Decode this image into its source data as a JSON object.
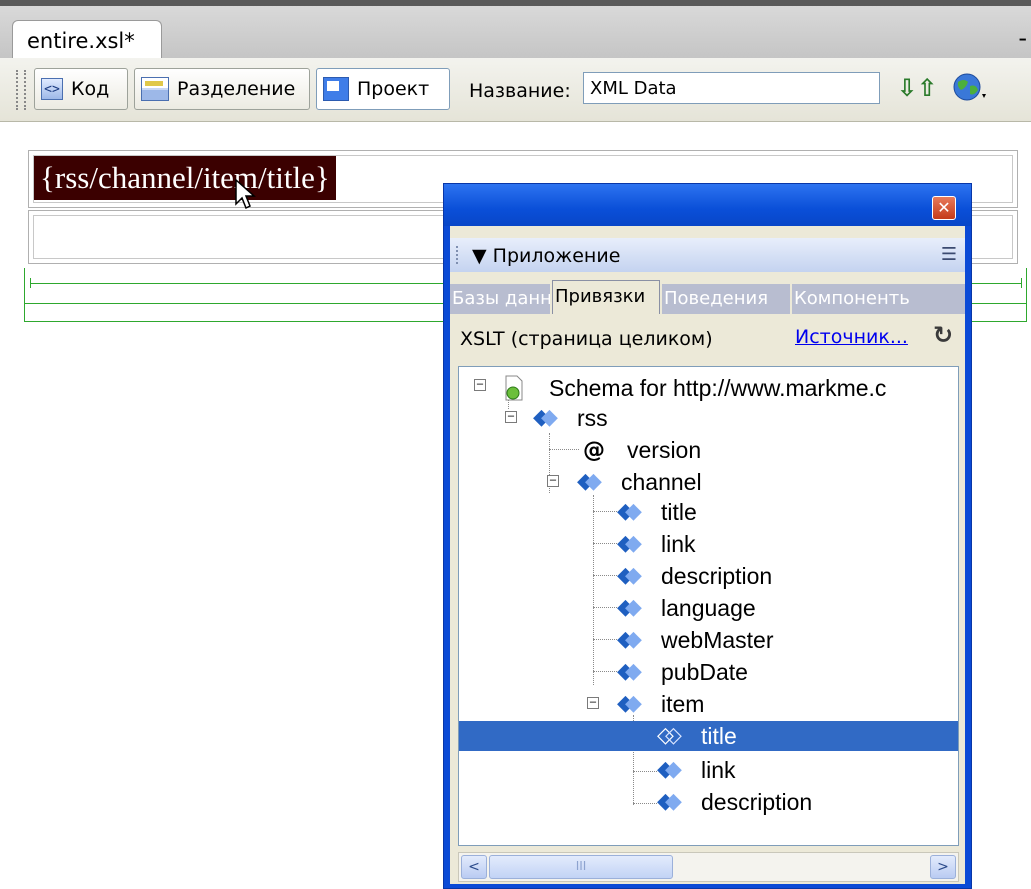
{
  "document": {
    "tab_title": "entire.xsl*",
    "minimize_glyph": "-"
  },
  "toolbar": {
    "code_label": "Код",
    "split_label": "Разделение",
    "design_label": "Проект",
    "title_label": "Название:",
    "title_value": "XML Data",
    "sort_glyph": "⇩⇧"
  },
  "design": {
    "xsl_field": "{rss/channel/item/title}"
  },
  "panel": {
    "close_glyph": "✕",
    "group_title": "▼ Приложение",
    "options_glyph": "☰",
    "tabs": [
      "Базы данны",
      "Привязки",
      "Поведения",
      "Компоненть"
    ],
    "active_tab": 1,
    "source_type": "XSLT (страница целиком)",
    "source_link": "Источник...",
    "refresh_glyph": "↻",
    "tree": [
      {
        "label": "Schema for http://www.markme.c",
        "type": "schema"
      },
      {
        "label": "rss",
        "type": "element"
      },
      {
        "label": "version",
        "type": "attribute"
      },
      {
        "label": "channel",
        "type": "element"
      },
      {
        "label": "title",
        "type": "element"
      },
      {
        "label": "link",
        "type": "element"
      },
      {
        "label": "description",
        "type": "element"
      },
      {
        "label": "language",
        "type": "element"
      },
      {
        "label": "webMaster",
        "type": "element"
      },
      {
        "label": "pubDate",
        "type": "element"
      },
      {
        "label": "item",
        "type": "element-repeating"
      },
      {
        "label": "title",
        "type": "element",
        "selected": true
      },
      {
        "label": "link",
        "type": "element"
      },
      {
        "label": "description",
        "type": "element"
      }
    ],
    "scroll": {
      "left": "<",
      "right": ">",
      "thumb": "III"
    }
  },
  "colors": {
    "selection": "#316ac5",
    "field_bg": "#3b0000",
    "table_border": "#2ea82e",
    "titlebar": "#0a4fd8"
  }
}
